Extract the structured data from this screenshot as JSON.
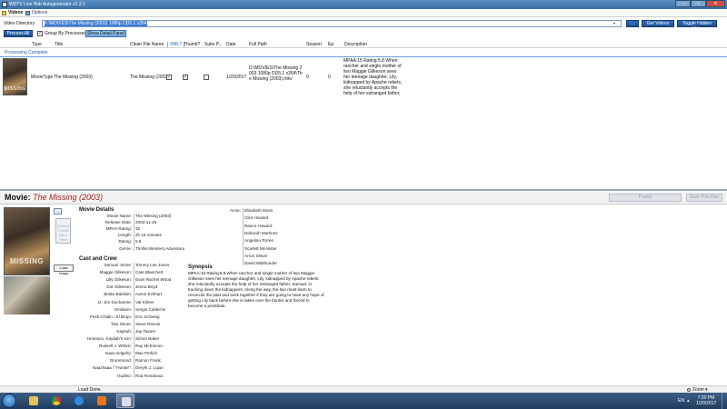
{
  "window": {
    "title": "WDTV Live Hub Autogenerator v2.3.1",
    "min": "–",
    "max": "□",
    "close": "✕"
  },
  "menu": {
    "tabs": [
      "Videos",
      "Options"
    ]
  },
  "directory": {
    "label": "Video Directory",
    "value": "F:\\MOVIES\\The Missing (2003) 1080p DD5.1 x264",
    "dropdown": "▾",
    "browse": "...",
    "get_videos": "Get Videos",
    "toggle_hidden": "Toggle Hidden Vids"
  },
  "toolbar": {
    "process_all": "Process All",
    "group_by_processed": "Group By Processed",
    "group_checked": "✓",
    "show_detail_panel": "Show Detail Panel"
  },
  "grid": {
    "columns": [
      "Type",
      "Title",
      "Clean File Name",
      "XML?",
      "Thumb?",
      "Subs P...",
      "Date",
      "Full Path",
      "Season",
      "Ep",
      "Description"
    ],
    "group_label": "Processing Complete",
    "rows": [
      {
        "type": "MovieType",
        "title": "The Missing (2003)",
        "clean_file_name": "The Missing (2003)",
        "xml": "✓",
        "thumb": "✓",
        "subs": "",
        "date": "1/20/2017",
        "full_path": "D:\\MOVIES\\The Missing 2003 1080p DD5.1 x264\\The Missing (2003).mkv",
        "season": "0",
        "ep": "0",
        "description": "MPAA:15 Rating:5.8 When rancher and single mother of two Maggie Gilkeson sees her teenage daughter, Lily, kidnapped by Apache rebels, she reluctantly accepts the help of her estranged father, Samuel, in tracking down the..."
      }
    ]
  },
  "detail": {
    "header_prefix": "Movie:",
    "header_title": "The Missing (2003)",
    "found_button": "Found",
    "save_button": "Save This Disc",
    "poster_text": "MISSING",
    "small_btn": "...",
    "embed_poster": "Embed Poster Here Here",
    "load_image": "Load Image",
    "movie_details_title": "Movie Details",
    "details": [
      {
        "label": "Movie Name:",
        "value": "The Missing (2003)"
      },
      {
        "label": "Release Date:",
        "value": "2003-11-26"
      },
      {
        "label": "MPAA Rating:",
        "value": "15"
      },
      {
        "label": "Length:",
        "value": "2h 15 minutes"
      },
      {
        "label": "Rating:",
        "value": "5.8"
      },
      {
        "label": "Genre:",
        "value": "Thriller,Western,Adventure"
      }
    ],
    "cast_title": "Cast and Crew",
    "cast": [
      {
        "role": "Samuel Jones:",
        "actor": "Tommy Lee Jones"
      },
      {
        "role": "Maggie Gilkeson:",
        "actor": "Cate Blanchett"
      },
      {
        "role": "Lilly Gilkeson:",
        "actor": "Evan Rachel Wood"
      },
      {
        "role": "Dot Gilkeson:",
        "actor": "Jenna Boyd"
      },
      {
        "role": "Brake Baldwin:",
        "actor": "Aaron Eckhart"
      },
      {
        "role": "Lt. Jim Ducharme:",
        "actor": "Val Kilmer"
      },
      {
        "role": "Emiliano:",
        "actor": "Sergio Calderón"
      },
      {
        "role": "Pesh-Chidin / El Brujo:",
        "actor": "Eric Schweig"
      },
      {
        "role": "Two Stone:",
        "actor": "Steve Reevis"
      },
      {
        "role": "Kayitah:",
        "actor": "Jay Tavare"
      },
      {
        "role": "Honesco, Kayitah's son:",
        "actor": "Simon Baker"
      },
      {
        "role": "Russell J. Wittick:",
        "actor": "Ray McKinnon"
      },
      {
        "role": "Isaac Edgerly:",
        "actor": "Max Perlich"
      },
      {
        "role": "Grummond:",
        "actor": "Ramon Frank"
      },
      {
        "role": "Naazhaaa / \"Hunter\":",
        "actor": "Deryle J. Lujan"
      },
      {
        "role": "Hudleo:",
        "actor": "Rod Rondeaux"
      }
    ],
    "cast2": [
      {
        "role": "Anne:",
        "actor": "Elisabeth Moss"
      },
      {
        "role": "",
        "actor": "Clint Howard"
      },
      {
        "role": "",
        "actor": "Rance Howard"
      },
      {
        "role": "",
        "actor": "Deborah Martinez"
      },
      {
        "role": "",
        "actor": "Angelina Torres"
      },
      {
        "role": "",
        "actor": "Scarlett McAlister"
      },
      {
        "role": "",
        "actor": "Arron Shiver"
      },
      {
        "role": "",
        "actor": "David Midthunder"
      }
    ],
    "synopsis_title": "Synopsis",
    "synopsis": "MPAA:15 Rating:5.8 When rancher and single mother of two Maggie Gilkeson sees her teenage daughter, Lily, kidnapped by Apache rebels, she reluctantly accepts the help of her estranged father, Samuel, in tracking down the kidnappers. Along the way, the two must learn to reconcile the past and work together if they are going to have any hope of getting Lily back before she is taken over the border and forced to become a prostitute."
  },
  "status": {
    "text": "Load Done.",
    "zoom": "Zoom ▾"
  },
  "taskbar": {
    "lang": "EN",
    "arrow": "▴",
    "time": "7:20 PM",
    "date": "1/20/2017"
  }
}
